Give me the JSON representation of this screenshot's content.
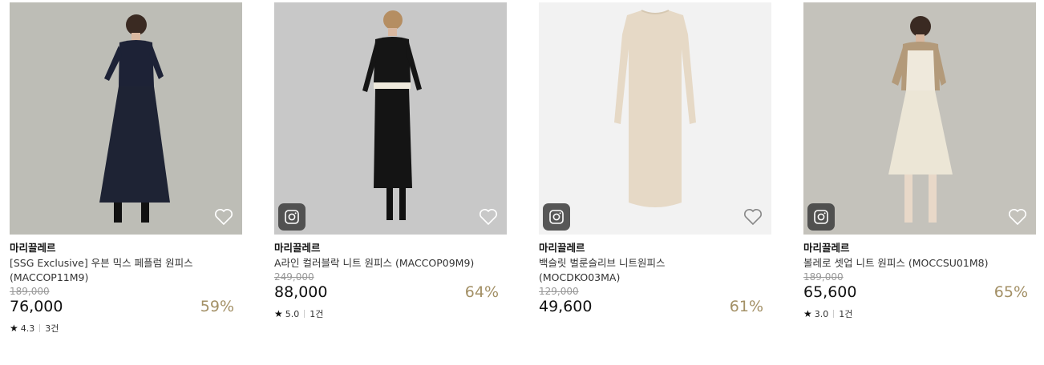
{
  "products": [
    {
      "brand": "마리끌레르",
      "title_line1": "[SSG Exclusive] 우븐 믹스 페플럼 원피스",
      "title_line2": "(MACCOP11M9)",
      "original_price": "189,000",
      "price": "76,000",
      "discount": "59%",
      "rating": "4.3",
      "review_count": "3건",
      "has_instagram_badge": false,
      "image": "woman-navy-tiered-dress-photo"
    },
    {
      "brand": "마리끌레르",
      "title_line1": "A라인 컬러블락 니트 원피스 (MACCOP09M9)",
      "title_line2": "",
      "original_price": "249,000",
      "price": "88,000",
      "discount": "64%",
      "rating": "5.0",
      "review_count": "1건",
      "has_instagram_badge": true,
      "image": "woman-black-knit-dress-photo"
    },
    {
      "brand": "마리끌레르",
      "title_line1": "백슬릿 벌룬슬리브 니트원피스",
      "title_line2": "(MOCDKO03MA)",
      "original_price": "129,000",
      "price": "49,600",
      "discount": "61%",
      "rating": "",
      "review_count": "",
      "has_instagram_badge": true,
      "image": "beige-knit-dress-flatlay-photo"
    },
    {
      "brand": "마리끌레르",
      "title_line1": "볼레로 셋업 니트 원피스 (MOCCSU01M8)",
      "title_line2": "",
      "original_price": "189,000",
      "price": "65,600",
      "discount": "65%",
      "rating": "3.0",
      "review_count": "1건",
      "has_instagram_badge": true,
      "image": "woman-cream-knit-dress-photo"
    }
  ],
  "colors": {
    "discount": "#a39066",
    "photo_background": "#bfbfba"
  }
}
